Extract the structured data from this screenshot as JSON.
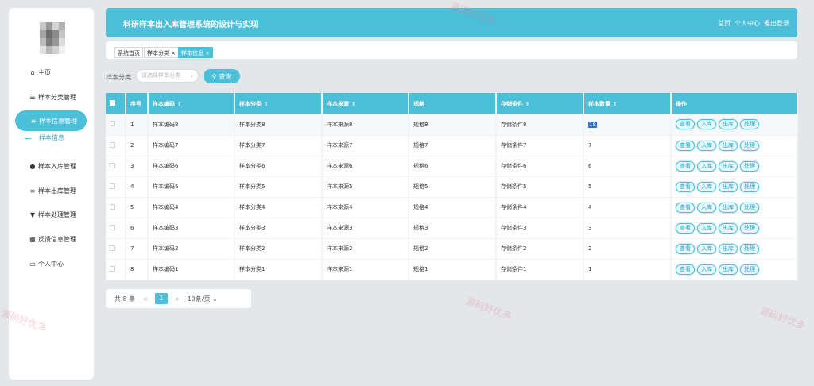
{
  "sidebar": {
    "items": [
      {
        "label": "主页",
        "icon": "home-icon"
      },
      {
        "label": "样本分类管理",
        "icon": "sliders-icon"
      },
      {
        "label": "样本信息管理",
        "icon": "list-icon"
      },
      {
        "label": "样本入库管理",
        "icon": "user-icon"
      },
      {
        "label": "样本出库管理",
        "icon": "list-icon"
      },
      {
        "label": "样本处理管理",
        "icon": "filter-icon"
      },
      {
        "label": "反馈信息管理",
        "icon": "grid-icon"
      },
      {
        "label": "个人中心",
        "icon": "card-icon"
      }
    ],
    "submenu_label": "样本信息"
  },
  "header": {
    "title": "科研样本出入库管理系统的设计与实现",
    "links": [
      "首页",
      "个人中心",
      "退出登录"
    ]
  },
  "tabs": [
    "系统首页",
    "样本分类",
    "样本信息"
  ],
  "search": {
    "label": "样本分类",
    "placeholder": "请选择样本分类",
    "button_label": "查询"
  },
  "table": {
    "columns": [
      "序号",
      "样本编码",
      "样本分类",
      "样本来源",
      "规格",
      "存储条件",
      "样本数量",
      "操作"
    ],
    "actions": [
      "查看",
      "入库",
      "出库",
      "处理"
    ],
    "rows": [
      [
        "1",
        "样本编码8",
        "样本分类8",
        "样本来源8",
        "规格8",
        "存储条件8",
        "18"
      ],
      [
        "2",
        "样本编码7",
        "样本分类7",
        "样本来源7",
        "规格7",
        "存储条件7",
        "7"
      ],
      [
        "3",
        "样本编码6",
        "样本分类6",
        "样本来源6",
        "规格6",
        "存储条件6",
        "6"
      ],
      [
        "4",
        "样本编码5",
        "样本分类5",
        "样本来源5",
        "规格5",
        "存储条件5",
        "5"
      ],
      [
        "5",
        "样本编码4",
        "样本分类4",
        "样本来源4",
        "规格4",
        "存储条件4",
        "4"
      ],
      [
        "6",
        "样本编码3",
        "样本分类3",
        "样本来源3",
        "规格3",
        "存储条件3",
        "3"
      ],
      [
        "7",
        "样本编码2",
        "样本分类2",
        "样本来源2",
        "规格2",
        "存储条件2",
        "2"
      ],
      [
        "8",
        "样本编码1",
        "样本分类1",
        "样本来源1",
        "规格1",
        "存储条件1",
        "1"
      ]
    ]
  },
  "pagination": {
    "total": "共 8 条",
    "prev": "<",
    "current_page": "1",
    "next": ">",
    "page_size": "10条/页"
  },
  "watermark": "源码好优多",
  "colors": {
    "accent": "#4bbfd8",
    "background": "#e3e7ea"
  }
}
